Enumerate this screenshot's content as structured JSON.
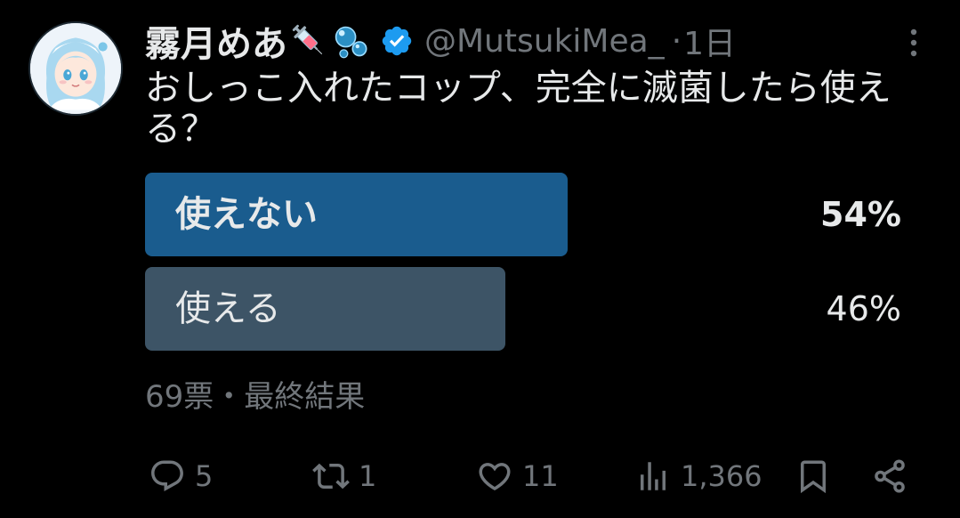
{
  "author": {
    "display_name": "霧月めあ",
    "name_emojis": [
      "syringe-emoji",
      "bubbles-emoji"
    ],
    "verified": true,
    "handle": "@MutsukiMea_",
    "separator": "·",
    "timestamp": "1日"
  },
  "tweet": {
    "text": "おしっこ入れたコップ、完全に滅菌したら使える？"
  },
  "poll": {
    "options": [
      {
        "label": "使えない",
        "percent_text": "54%",
        "percent": 54,
        "winner": true
      },
      {
        "label": "使える",
        "percent_text": "46%",
        "percent": 46,
        "winner": false
      }
    ],
    "meta": "69票・最終結果"
  },
  "actions": {
    "reply": {
      "icon": "reply-icon",
      "count": "5"
    },
    "retweet": {
      "icon": "retweet-icon",
      "count": "1"
    },
    "like": {
      "icon": "heart-icon",
      "count": "11"
    },
    "views": {
      "icon": "views-icon",
      "count": "1,366"
    },
    "bookmark": {
      "icon": "bookmark-icon"
    },
    "share": {
      "icon": "share-icon"
    }
  },
  "colors": {
    "background": "#000000",
    "text_primary": "#e7e9ea",
    "text_secondary": "#71767b",
    "poll_winner_bar": "#1a5c8e",
    "poll_other_bar": "#3d5466",
    "verified_badge": "#1d9bf0"
  }
}
